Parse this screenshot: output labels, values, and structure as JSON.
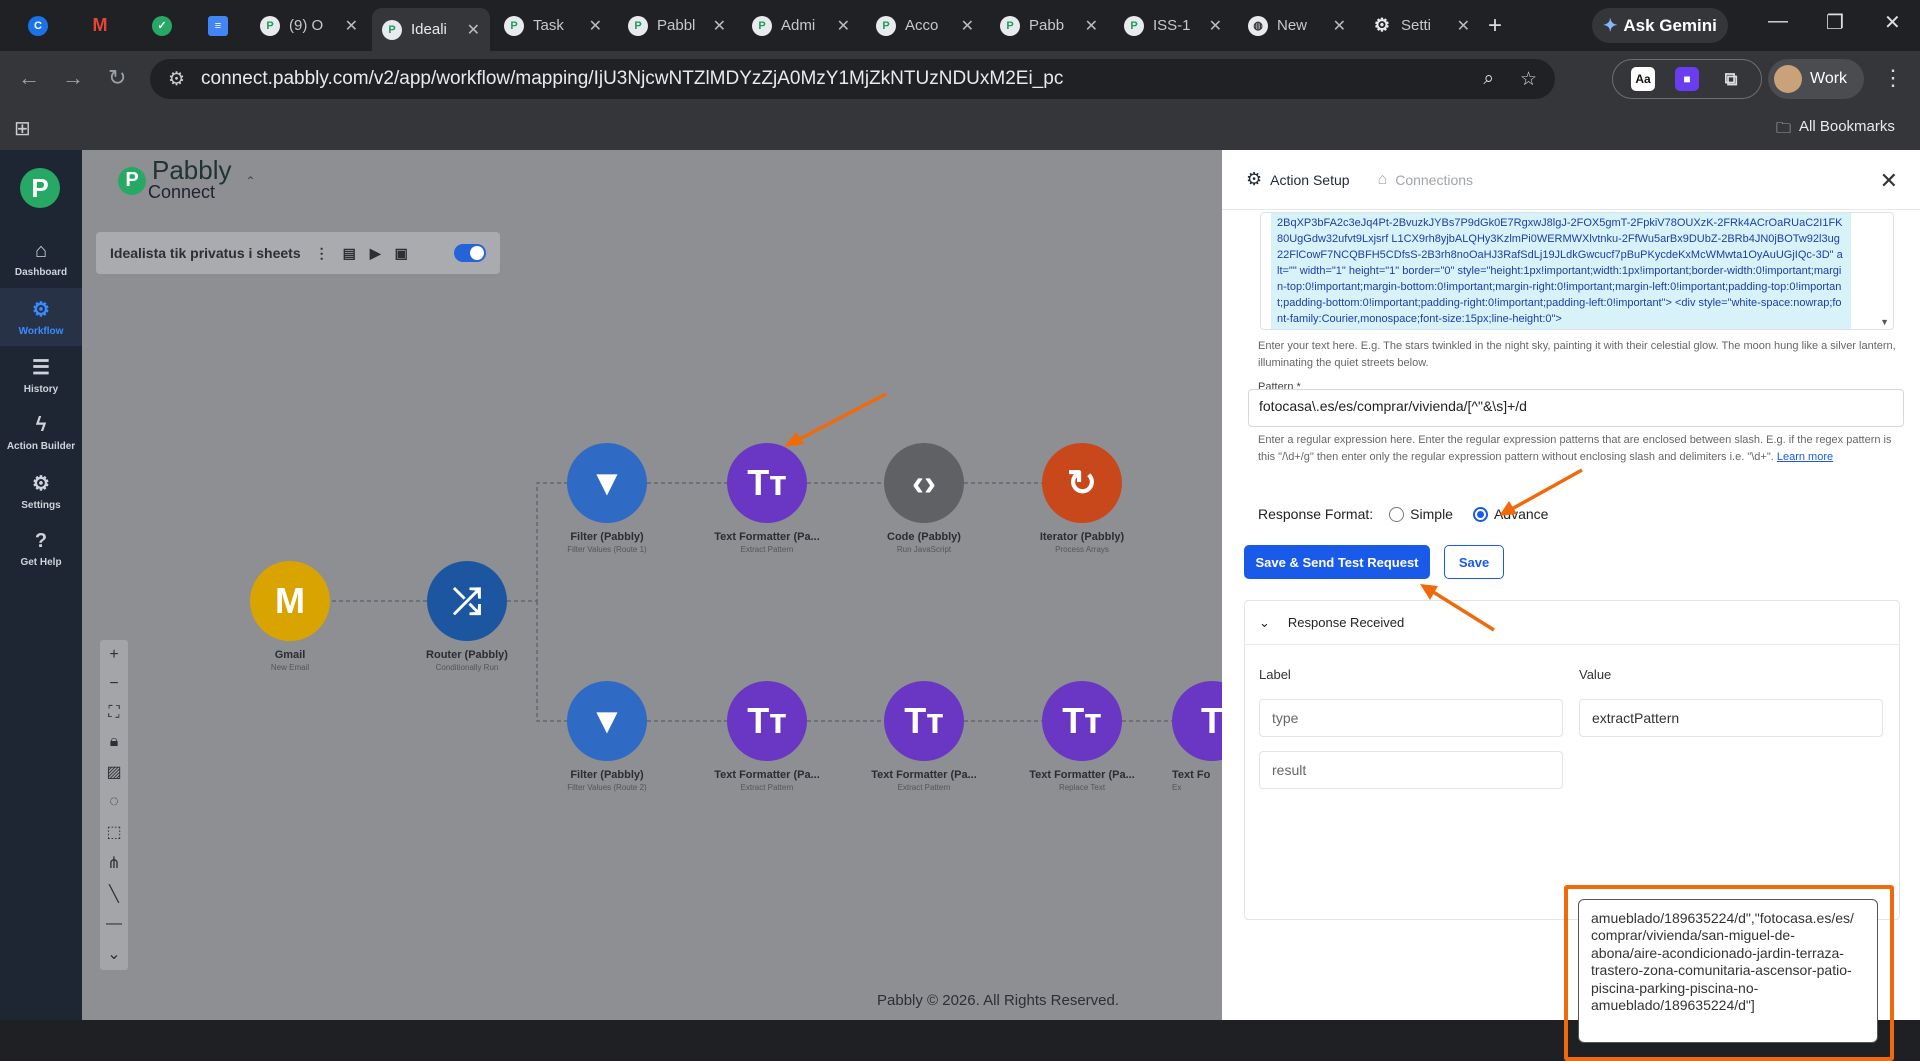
{
  "browser": {
    "tabs": [
      {
        "icon": "chrome-icon",
        "label": ""
      },
      {
        "icon": "gmail-icon",
        "label": ""
      },
      {
        "icon": "extension-icon",
        "label": ""
      },
      {
        "icon": "docs-icon",
        "label": ""
      },
      {
        "icon": "pabbly-icon",
        "label": "(9) O"
      },
      {
        "icon": "pabbly-icon",
        "label": "Ideali"
      },
      {
        "icon": "pabbly-icon",
        "label": "Task"
      },
      {
        "icon": "pabbly-icon",
        "label": "Pabbl"
      },
      {
        "icon": "pabbly-icon",
        "label": "Admi"
      },
      {
        "icon": "pabbly-icon",
        "label": "Acco"
      },
      {
        "icon": "pabbly-icon",
        "label": "Pabb"
      },
      {
        "icon": "pabbly-icon",
        "label": "ISS-1"
      },
      {
        "icon": "globe-icon",
        "label": "New"
      },
      {
        "icon": "gear-icon",
        "label": "Setti"
      }
    ],
    "gemini_label": "Ask Gemini",
    "url": "connect.pabbly.com/v2/app/workflow/mapping/IjU3NjcwNTZlMDYzZjA0MzY1MjZkNTUzNDUxM2Ei_pc",
    "profile_label": "Work",
    "all_bookmarks": "All Bookmarks"
  },
  "sidebar": [
    {
      "icon": "home-icon",
      "label": "Dashboard"
    },
    {
      "icon": "workflow-icon",
      "label": "Workflow"
    },
    {
      "icon": "history-icon",
      "label": "History"
    },
    {
      "icon": "bolt-icon",
      "label": "Action Builder"
    },
    {
      "icon": "gear-icon",
      "label": "Settings"
    },
    {
      "icon": "help-icon",
      "label": "Get Help"
    }
  ],
  "brand": {
    "name": "Pabbly",
    "sub": "Connect"
  },
  "workflow": {
    "name": "Idealista tik privatus i sheets"
  },
  "nodes": [
    {
      "label": "Gmail",
      "sub": "New Email",
      "color": "#d9a400",
      "glyph": "M"
    },
    {
      "label": "Router (Pabbly)",
      "sub": "Conditionally Run",
      "color": "#1d56a0",
      "glyph": "⤮"
    },
    {
      "label": "Filter (Pabbly)",
      "sub": "Filter Values (Route 1)",
      "color": "#2f6ac4",
      "glyph": "▼"
    },
    {
      "label": "Text Formatter (Pa...",
      "sub": "Extract Pattern",
      "color": "#6a36c4",
      "glyph": "Tт"
    },
    {
      "label": "Code (Pabbly)",
      "sub": "Run JavaScript",
      "color": "#5f6164",
      "glyph": "‹›"
    },
    {
      "label": "Iterator (Pabbly)",
      "sub": "Process Arrays",
      "color": "#c8481c",
      "glyph": "↻"
    },
    {
      "label": "Filter (Pabbly)",
      "sub": "Filter Values (Route 2)",
      "color": "#2f6ac4",
      "glyph": "▼"
    },
    {
      "label": "Text Formatter (Pa...",
      "sub": "Extract Pattern",
      "color": "#6a36c4",
      "glyph": "Tт"
    },
    {
      "label": "Text Formatter (Pa...",
      "sub": "Extract Pattern",
      "color": "#6a36c4",
      "glyph": "Tт"
    },
    {
      "label": "Text Formatter (Pa...",
      "sub": "Replace Text",
      "color": "#6a36c4",
      "glyph": "Tт"
    },
    {
      "label": "Text Fo",
      "sub": "Ex",
      "color": "#6a36c4",
      "glyph": "T"
    }
  ],
  "footer": "Pabbly © 2026. All Rights Reserved.",
  "panel": {
    "tab_action_setup": "Action Setup",
    "tab_connections": "Connections",
    "code_text": "2BqXP3bFA2c3eJq4Pt-2BvuzkJYBs7P9dGk0E7RgxwJ8lgJ-2FOX5gmT-2FpkiV78OUXzK-2FRk4ACrOaRUaC2I1FK80UgGdw32ufvt9Lxjsrf L1CX9rh8yjbALQHy3KzlmPi0WERMWXlvtnku-2FfWu5arBx9DUbZ-2BRb4JN0jBOTw92l3ug22FlCowF7NCQBFH5CDfsS-2B3rh8noOaHJ3RafSdLj19JLdkGwcucf7pBuPKycdeKxMcWMwta1OyAuUGjIQc-3D\" alt=\"\" width=\"1\" height=\"1\" border=\"0\" style=\"height:1px!important;width:1px!important;border-width:0!important;margin-top:0!important;margin-bottom:0!important;margin-right:0!important;margin-left:0!important;padding-top:0!important;padding-bottom:0!important;padding-right:0!important;padding-left:0!important\"> <div style=\"white-space:nowrap;font-family:Courier,monospace;font-size:15px;line-height:0\">",
    "text_help": "Enter your text here. E.g. The stars twinkled in the night sky, painting it with their celestial glow. The moon hung like a silver lantern, illuminating the quiet streets below.",
    "pattern_label": "Pattern *",
    "pattern_value": "fotocasa\\.es/es/comprar/vivienda/[^\"&\\s]+/d",
    "pattern_help": "Enter a regular expression here. Enter the regular expression patterns that are enclosed between slash. E.g. if the regex pattern is this \"/\\d+/g\" then enter only the regular expression pattern without enclosing slash and delimiters i.e. \"\\d+\".",
    "learn_more": "Learn more",
    "response_format_label": "Response Format:",
    "opt_simple": "Simple",
    "opt_advance": "Advance",
    "selected_format": "Advance",
    "btn_send": "Save & Send Test Request",
    "btn_save": "Save",
    "response_title": "Response Received",
    "col_label": "Label",
    "col_value": "Value",
    "rows": [
      {
        "label": "type",
        "value": "extractPattern"
      },
      {
        "label": "result",
        "value": "amueblado/189635224/d\",\"fotocasa.es/es/comprar/vivienda/san-miguel-de-abona/aire-acondicionado-jardin-terraza-trastero-zona-comunitaria-ascensor-patio-piscina-parking-piscina-no-amueblado/189635224/d\"]"
      }
    ]
  },
  "colors": {
    "accent": "#1a5ae8",
    "highlight": "#f06a0c",
    "pabbly_green": "#27a864"
  }
}
